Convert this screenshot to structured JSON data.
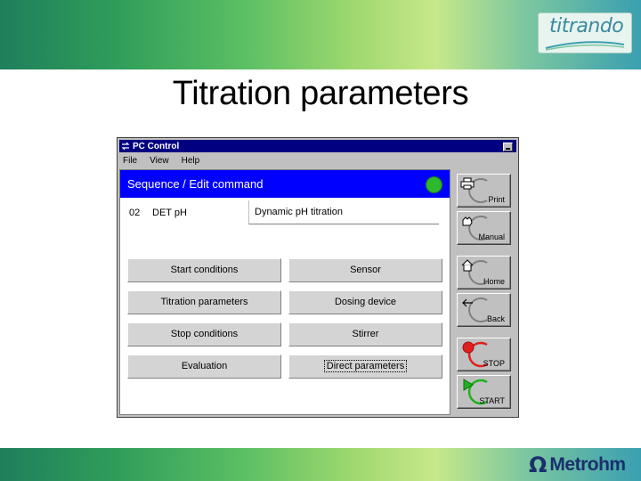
{
  "slide": {
    "title": "Titration parameters",
    "logo_text": "titrando",
    "brand_omega": "Ω",
    "brand": "Metrohm"
  },
  "window": {
    "title": "PC Control",
    "menu": [
      "File",
      "View",
      "Help"
    ]
  },
  "sequence": {
    "header": "Sequence / Edit command",
    "status_color": "#2db82d",
    "row": {
      "number": "02",
      "name": "DET pH",
      "description": "Dynamic pH titration"
    }
  },
  "command_buttons": [
    {
      "label": "Start conditions"
    },
    {
      "label": "Sensor"
    },
    {
      "label": "Titration parameters"
    },
    {
      "label": "Dosing device"
    },
    {
      "label": "Stop conditions"
    },
    {
      "label": "Stirrer"
    },
    {
      "label": "Evaluation"
    },
    {
      "label": "Direct parameters"
    }
  ],
  "side_buttons": {
    "print": {
      "label": "Print",
      "icon": "printer-icon"
    },
    "manual": {
      "label": "Manual",
      "icon": "hand-icon"
    },
    "home": {
      "label": "Home",
      "icon": "house-icon"
    },
    "back": {
      "label": "Back",
      "icon": "back-arrow-icon"
    },
    "stop": {
      "label": "STOP",
      "icon": "red-dot-icon"
    },
    "start": {
      "label": "START",
      "icon": "green-triangle-icon"
    }
  },
  "colors": {
    "header_blue": "#0000ff",
    "stop_red": "#e02020",
    "start_green": "#20b020",
    "brand_blue": "#1a2f6b"
  }
}
